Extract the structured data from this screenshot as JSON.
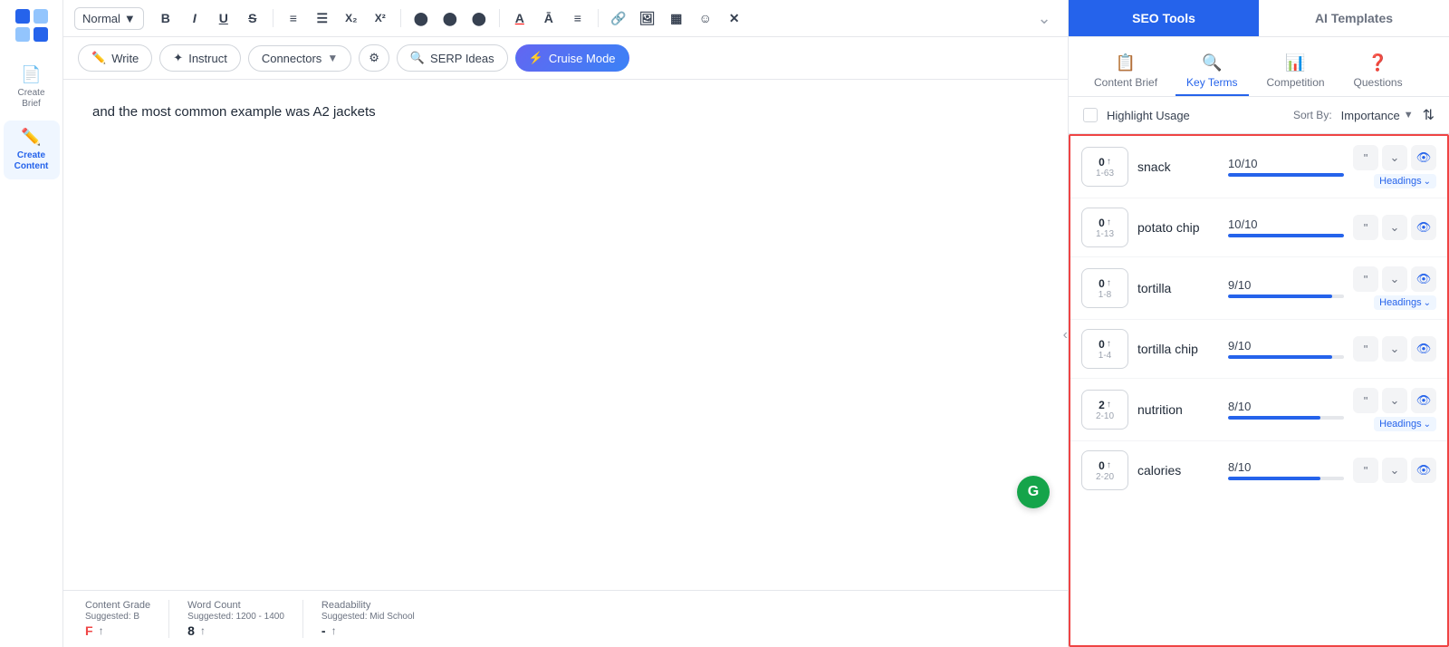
{
  "sidebar": {
    "logo_alt": "App Logo",
    "items": [
      {
        "id": "create-brief",
        "label": "Create Brief",
        "icon": "📄",
        "active": false
      },
      {
        "id": "create-content",
        "label": "Create Content",
        "icon": "✏️",
        "active": true
      }
    ]
  },
  "toolbar": {
    "format_select": "Normal",
    "expand_btn": "⌄",
    "buttons": [
      {
        "id": "bold",
        "label": "B",
        "title": "Bold"
      },
      {
        "id": "italic",
        "label": "I",
        "title": "Italic"
      },
      {
        "id": "underline",
        "label": "U",
        "title": "Underline"
      },
      {
        "id": "strikethrough",
        "label": "S",
        "title": "Strikethrough"
      },
      {
        "id": "ordered-list",
        "label": "≡",
        "title": "Ordered List"
      },
      {
        "id": "unordered-list",
        "label": "☰",
        "title": "Unordered List"
      },
      {
        "id": "subscript",
        "label": "X₂",
        "title": "Subscript"
      },
      {
        "id": "superscript",
        "label": "X²",
        "title": "Superscript"
      },
      {
        "id": "align-left",
        "label": "⬤",
        "title": "Align Left"
      },
      {
        "id": "align-right",
        "label": "⬤",
        "title": "Align Right"
      },
      {
        "id": "indent",
        "label": "⬤",
        "title": "Indent"
      },
      {
        "id": "font-color",
        "label": "A",
        "title": "Font Color"
      },
      {
        "id": "font-bg",
        "label": "Ā",
        "title": "Font Background"
      },
      {
        "id": "align",
        "label": "≡",
        "title": "Alignment"
      },
      {
        "id": "link",
        "label": "🔗",
        "title": "Link"
      },
      {
        "id": "image",
        "label": "⬜",
        "title": "Image"
      },
      {
        "id": "table",
        "label": "▦",
        "title": "Table"
      },
      {
        "id": "emoji",
        "label": "☺",
        "title": "Emoji"
      },
      {
        "id": "clear",
        "label": "✕",
        "title": "Clear Formatting"
      }
    ]
  },
  "action_bar": {
    "write_btn": "Write",
    "instruct_btn": "Instruct",
    "connectors_btn": "Connectors",
    "settings_icon": "⚙",
    "serp_btn": "SERP Ideas",
    "cruise_btn": "Cruise Mode"
  },
  "editor": {
    "content": "and the most common example was A2 jackets",
    "grammarly_icon": "G"
  },
  "status_bar": {
    "content_grade_label": "Content Grade",
    "content_grade_suggested": "Suggested: B",
    "content_grade_value": "F",
    "content_grade_arrow": "↑",
    "word_count_label": "Word Count",
    "word_count_suggested": "Suggested: 1200 - 1400",
    "word_count_value": "8",
    "word_count_arrow": "↑",
    "readability_label": "Readability",
    "readability_suggested": "Suggested: Mid School",
    "readability_value": "-",
    "readability_arrow": "↑"
  },
  "right_panel": {
    "seo_tools_label": "SEO Tools",
    "ai_templates_label": "AI Templates",
    "sub_tabs": [
      {
        "id": "content-brief",
        "label": "Content Brief",
        "icon": "📋",
        "active": false
      },
      {
        "id": "key-terms",
        "label": "Key Terms",
        "icon": "🔍",
        "active": true
      },
      {
        "id": "competition",
        "label": "Competition",
        "icon": "📊",
        "active": false
      },
      {
        "id": "questions",
        "label": "Questions",
        "icon": "❓",
        "active": false
      }
    ],
    "highlight_usage_label": "Highlight Usage",
    "sort_label": "Sort By:",
    "sort_value": "Importance",
    "terms": [
      {
        "id": "snack",
        "count": "0",
        "arrow": "↑",
        "range": "1-63",
        "name": "snack",
        "score": "10/10",
        "score_pct": 100,
        "has_headings": true
      },
      {
        "id": "potato-chip",
        "count": "0",
        "arrow": "↑",
        "range": "1-13",
        "name": "potato chip",
        "score": "10/10",
        "score_pct": 100,
        "has_headings": false
      },
      {
        "id": "tortilla",
        "count": "0",
        "arrow": "↑",
        "range": "1-8",
        "name": "tortilla",
        "score": "9/10",
        "score_pct": 90,
        "has_headings": true
      },
      {
        "id": "tortilla-chip",
        "count": "0",
        "arrow": "↑",
        "range": "1-4",
        "name": "tortilla chip",
        "score": "9/10",
        "score_pct": 90,
        "has_headings": false
      },
      {
        "id": "nutrition",
        "count": "2",
        "arrow": "↑",
        "range": "2-10",
        "name": "nutrition",
        "score": "8/10",
        "score_pct": 80,
        "has_headings": true
      },
      {
        "id": "calories",
        "count": "0",
        "arrow": "↑",
        "range": "2-20",
        "name": "calories",
        "score": "8/10",
        "score_pct": 80,
        "has_headings": false
      }
    ]
  }
}
